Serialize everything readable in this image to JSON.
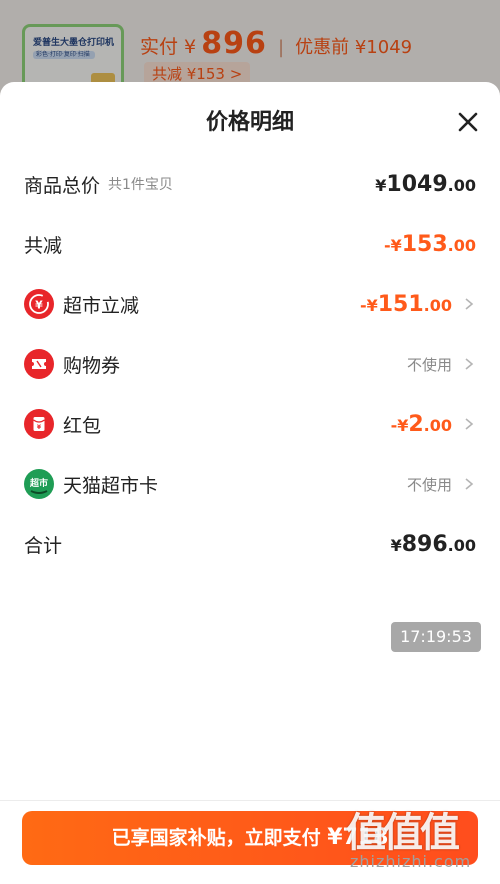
{
  "background": {
    "thumb_title": "爱普生大墨仓打印机",
    "thumb_sub": "彩色·打印·复印·扫描",
    "price_label": "实付 ¥",
    "price": "896",
    "sep": "|",
    "orig_price": "优惠前 ¥1049",
    "save_tag": "共减 ¥153 >"
  },
  "sheet": {
    "title": "价格明细"
  },
  "rows": {
    "total": {
      "label": "商品总价",
      "sub": "共1件宝贝",
      "cur": "¥",
      "int": "1049",
      "dec": ".00"
    },
    "discount": {
      "label": "共减",
      "cur": "-¥",
      "int": "153",
      "dec": ".00"
    },
    "supermarket": {
      "label": "超市立减",
      "cur": "-¥",
      "int": "151",
      "dec": ".00"
    },
    "coupon": {
      "label": "购物券",
      "value": "不使用"
    },
    "redpacket": {
      "label": "红包",
      "cur": "-¥",
      "int": "2",
      "dec": ".00"
    },
    "tmallcard": {
      "label": "天猫超市卡",
      "value": "不使用"
    },
    "sum": {
      "label": "合计",
      "cur": "¥",
      "int": "896",
      "dec": ".00"
    }
  },
  "timestamp": "17:19:53",
  "pay_button": {
    "label": "已享国家补贴，立即支付 ",
    "amount": "¥718"
  },
  "watermark": {
    "logo": "值值值",
    "text": "zhizhizhi.com"
  },
  "colors": {
    "accent": "#ff5a1a",
    "icon_red": "#e8262a",
    "icon_green": "#1f9d55"
  }
}
